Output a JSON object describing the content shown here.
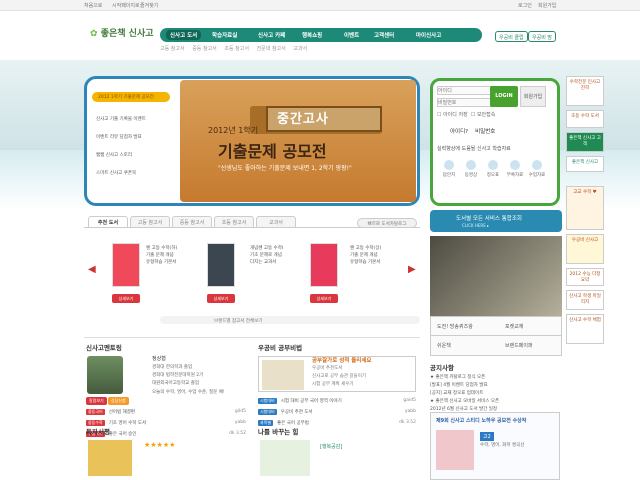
{
  "topbar": {
    "home": "처음으로",
    "add_home": "시작페이지로",
    "bookmark": "즐겨찾기",
    "login": "로그인",
    "join": "회원가입"
  },
  "brand": {
    "name": "좋은책 신사고"
  },
  "nav": {
    "items": [
      "신사고 도서",
      "학습자료실",
      "신사고 카페",
      "행복쇼핑",
      "이벤트",
      "고객센터",
      "마이신사고"
    ]
  },
  "subnav": [
    "고등 참고서",
    "중등 참고서",
    "초등 참고서",
    "전문대 참고서",
    "교과서"
  ],
  "header_buttons": {
    "club": "우공비 클럽",
    "uk": "우공비 맘"
  },
  "banner": {
    "pill": "2012 1학기 기출문제 공모전",
    "left_items": [
      "신사고 기출 기록물 이벤트",
      "이벤트 리뷰 당첨자 발표",
      "쌤쌤 신사고 스토리",
      "스마트 신사고 쿠폰북"
    ],
    "sign": "중간고사",
    "sub": "2012년 1학기",
    "title": "기출문제 공모전",
    "quote": "\"선생님도 좋아하는 기출문제 보내면 1, 2학기 팡팡!\""
  },
  "login": {
    "id_placeholder": "아이디",
    "pw_placeholder": "비밀번호",
    "login_btn": "LOGIN",
    "join_btn": "회원가입",
    "save_id": "아이디 저장",
    "secure": "보안접속",
    "find_id": "아이디?",
    "find_pw": "비밀번호",
    "help": "실력향상에 도움될 신사고 학습자료",
    "icons": [
      "답안지",
      "동영상",
      "정오표",
      "부록자료",
      "수업자료"
    ]
  },
  "side_buttons": [
    "수학전문 민사고 진학",
    "초등 수학 도서",
    "좋은책 신사고 고객",
    "좋은책 신사고",
    "고교 수학 ♥",
    "우공비 신사고",
    "2012 수능 다정 요약",
    "신사고 학생 마일리지",
    "신사고 수학 체험"
  ],
  "book_tabs": [
    "추천 도서",
    "고등 참고서",
    "중등 참고서",
    "초등 참고서",
    "교과서"
  ],
  "book_all": "빠르로 도서카탈로그",
  "books": [
    {
      "cover_color": "#f04a5a",
      "lines": [
        "쎈 고등 수학(하)",
        "기출 문제 개념",
        "유형학습 기본서"
      ],
      "detail": "상세보기"
    },
    {
      "cover_color": "#3c4650",
      "lines": [
        "개념쎈 고등 수학I",
        "기초 문제로 개념",
        "다지는 교과서"
      ],
      "detail": "상세보기"
    },
    {
      "cover_color": "#e83a5a",
      "lines": [
        "쎈 고등 수학(상)",
        "기출 문제 개념",
        "유형학습 기본서"
      ],
      "detail": "상세보기"
    }
  ],
  "more_books": "브랜드별 참고서 전체보기",
  "promo": {
    "title": "도서별 모든 서비스 통합조회",
    "sub": "CLICK HERE ▸"
  },
  "video_controls": {
    "a": "도전! 방송퀴즈왕",
    "b": "포켓교재",
    "c": "쉬운책",
    "d": "브랜드페이퍼"
  },
  "teacher": {
    "heading": "신사고멘토링",
    "name": "정상협",
    "lines": [
      "경희대 한의학과 졸업",
      "경희대 법학전문대학원 2기",
      "대원외국어고등학교 졸업"
    ],
    "desc": "오늘의 수학, 영어, 수업 수준, 질문 예!",
    "btn1": "칼럼보기",
    "btn2": "상담신청",
    "rows": [
      {
        "tag": "중등국어",
        "text": "선어법 해결편",
        "num": "gild5"
      },
      {
        "tag": "중등수학",
        "text": "기초 영어 수학 도서",
        "num": "yabb"
      },
      {
        "tag": "수능국어",
        "text": "좋은 국어 승인",
        "num": "dk 3.52"
      }
    ]
  },
  "study": {
    "heading": "우공비 공부비법",
    "title": "공부잘가로 성적 올리세요",
    "desc": [
      "우공비 추천도서",
      "신사고로 공부 습관 길들이기",
      "시험 공부 계획 세우기"
    ],
    "rows": [
      {
        "tag": "시험대비",
        "text": "시험 대비 공부 국어 영역 이야기",
        "num": "gaid5"
      },
      {
        "tag": "시험대비",
        "text": "우공비 추천 도서",
        "num": "yabb"
      },
      {
        "tag": "과목별",
        "text": "좋은 국어 공부법",
        "num": "dk 3.52"
      }
    ]
  },
  "notice": {
    "heading": "공지사항",
    "rows": [
      "★ 좋은책 카탈로그 정식 오픈",
      "[발표] 4월 이벤트 당첨자 발표",
      "[공지] 교재 정오표 업데이트",
      "★ 좋은책 신사고 모바일 서비스 오픈",
      "2012년 6월 신사고 도서 발간 일정"
    ]
  },
  "contest": {
    "title": "제9회 신사고 스티디 노하우 공모전 수상작",
    "label": "고2",
    "sub": "수학, 영어, 화학 쌍곡선"
  },
  "bottom": {
    "reader_heading": "독자서평",
    "share_heading": "나를 바꾸는 힘",
    "share_item": "[행복공감]"
  }
}
